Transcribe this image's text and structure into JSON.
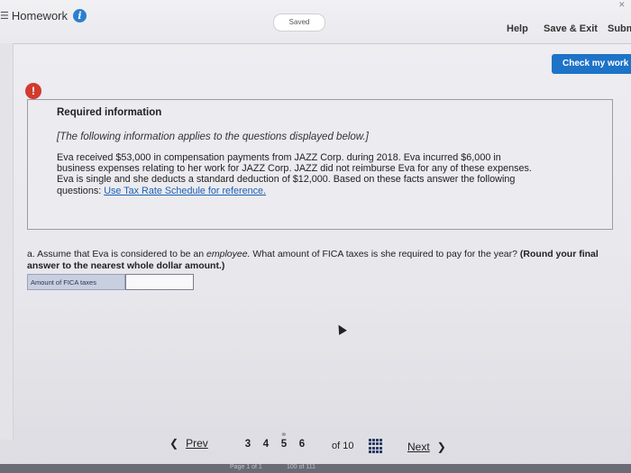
{
  "header": {
    "title": "Homework",
    "saved_label": "Saved",
    "help_label": "Help",
    "save_exit_label": "Save & Exit",
    "submit_label": "Subm"
  },
  "actions": {
    "check_my_work_label": "Check my work"
  },
  "required": {
    "title": "Required information",
    "subtitle": "[The following information applies to the questions displayed below.]",
    "body_line1": "Eva received $53,000 in compensation payments from JAZZ Corp. during 2018. Eva incurred $6,000 in",
    "body_line2": "business expenses relating to her work for JAZZ Corp. JAZZ did not reimburse Eva for any of these expenses.",
    "body_line3": "Eva is single and she deducts a standard deduction of $12,000. Based on these facts answer the following",
    "body_line4_prefix": "questions: ",
    "body_link": "Use Tax Rate Schedule for reference."
  },
  "question": {
    "prefix": "a. Assume that Eva is considered to be an ",
    "emphasis": "employee.",
    "middle": " What amount of FICA taxes is she required to pay for the year? ",
    "bold_part": "(Round your final answer to the nearest whole dollar amount.)",
    "answer_label": "Amount of FICA taxes",
    "answer_value": ""
  },
  "pager": {
    "prev_label": "Prev",
    "next_label": "Next",
    "pages": [
      "3",
      "4",
      "5",
      "6"
    ],
    "of_total": "of 10",
    "footer_page": "Page 1 of 1",
    "footer_num": "100 of 111"
  }
}
